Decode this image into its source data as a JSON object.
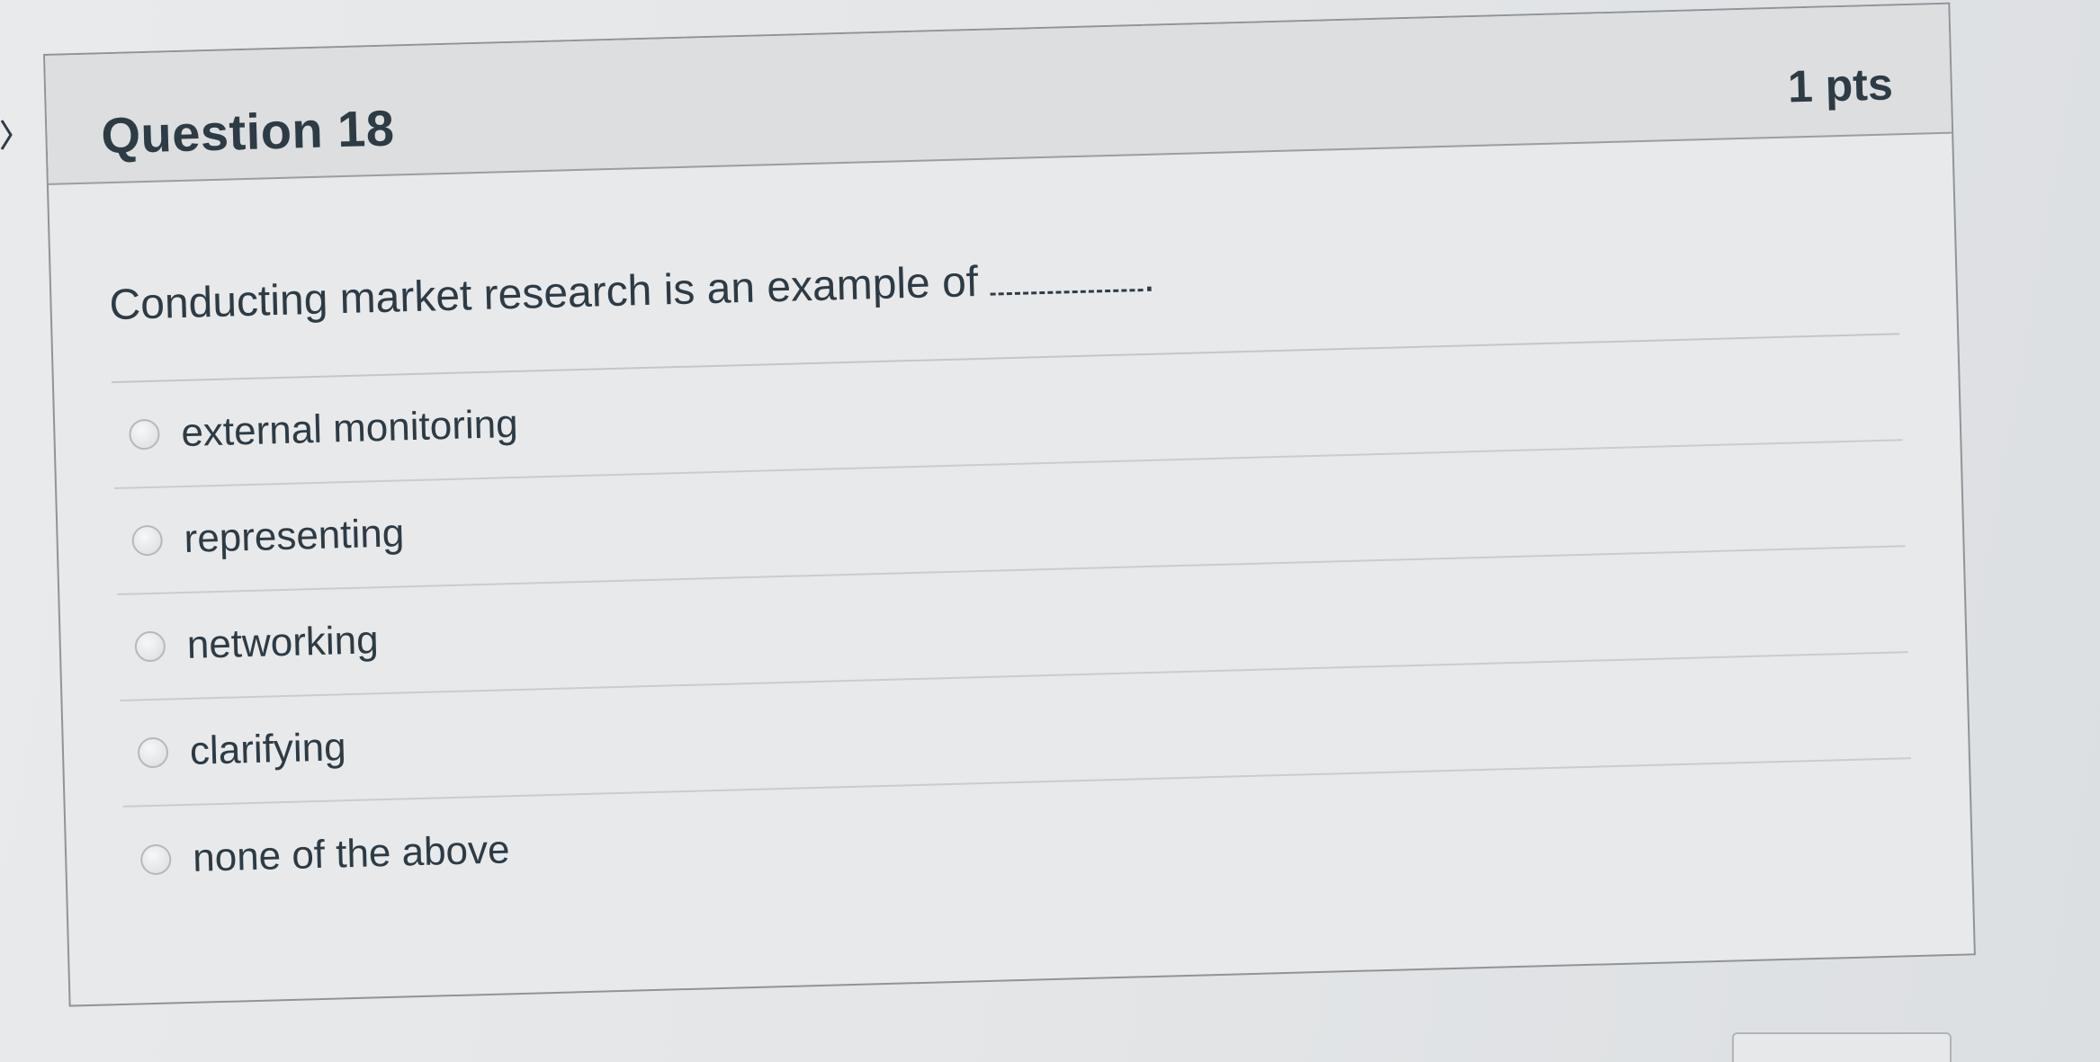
{
  "question": {
    "title": "Question 18",
    "points": "1 pts",
    "text": "Conducting market research is an example of",
    "text_suffix": "."
  },
  "answers": [
    {
      "label": "external monitoring",
      "selected": false
    },
    {
      "label": "representing",
      "selected": false
    },
    {
      "label": "networking",
      "selected": false
    },
    {
      "label": "clarifying",
      "selected": false
    },
    {
      "label": "none of the above",
      "selected": false
    }
  ],
  "icons": {
    "collapse": "chevron-right-icon",
    "radio": "radio-unchecked-icon"
  },
  "colors": {
    "text": "#2d3b45",
    "header_bg": "#dcdee0",
    "card_bg": "#e8e9eb",
    "border": "#8f9499"
  }
}
